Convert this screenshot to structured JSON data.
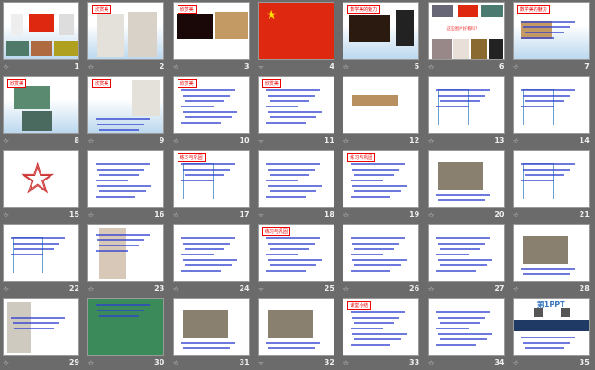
{
  "view": "slide-sorter",
  "colors": {
    "background": "#6b6b6b",
    "title": "#e00000",
    "text": "#3040d0",
    "flag": "#de2910"
  },
  "slides": [
    {
      "n": "1",
      "title": "",
      "kind": "collage"
    },
    {
      "n": "2",
      "title": "欣赏美",
      "kind": "dancers"
    },
    {
      "n": "3",
      "title": "欣赏美",
      "kind": "pyramid"
    },
    {
      "n": "4",
      "title": "",
      "kind": "flag"
    },
    {
      "n": "5",
      "title": "数学美的魅力",
      "kind": "night"
    },
    {
      "n": "6",
      "title": "",
      "caption": "这些图片好看吗？",
      "kind": "gallery"
    },
    {
      "n": "7",
      "title": "数学美的魅力",
      "kind": "pyr2"
    },
    {
      "n": "8",
      "title": "欣赏美",
      "kind": "swan"
    },
    {
      "n": "9",
      "title": "欣赏美",
      "kind": "dancer1"
    },
    {
      "n": "10",
      "title": "欣赏美",
      "kind": "text"
    },
    {
      "n": "11",
      "title": "欣赏美",
      "kind": "text"
    },
    {
      "n": "12",
      "title": "",
      "kind": "scroll"
    },
    {
      "n": "13",
      "title": "",
      "kind": "diagram"
    },
    {
      "n": "14",
      "title": "",
      "kind": "diagram"
    },
    {
      "n": "15",
      "title": "",
      "kind": "star"
    },
    {
      "n": "16",
      "title": "",
      "kind": "text"
    },
    {
      "n": "17",
      "title": "练习与巩固",
      "kind": "diagram"
    },
    {
      "n": "18",
      "title": "",
      "kind": "text"
    },
    {
      "n": "19",
      "title": "练习与巩固",
      "kind": "text"
    },
    {
      "n": "20",
      "title": "",
      "kind": "photo"
    },
    {
      "n": "21",
      "title": "",
      "kind": "diagram"
    },
    {
      "n": "22",
      "title": "",
      "kind": "diagram"
    },
    {
      "n": "23",
      "title": "",
      "kind": "dancer2"
    },
    {
      "n": "24",
      "title": "",
      "kind": "text"
    },
    {
      "n": "25",
      "title": "练习与巩固",
      "kind": "text"
    },
    {
      "n": "26",
      "title": "",
      "kind": "text"
    },
    {
      "n": "27",
      "title": "",
      "kind": "text"
    },
    {
      "n": "28",
      "title": "",
      "kind": "photo"
    },
    {
      "n": "29",
      "title": "",
      "kind": "statue"
    },
    {
      "n": "30",
      "title": "",
      "kind": "green"
    },
    {
      "n": "31",
      "title": "",
      "kind": "photo"
    },
    {
      "n": "32",
      "title": "",
      "kind": "photo"
    },
    {
      "n": "33",
      "title": "课堂小结",
      "kind": "text"
    },
    {
      "n": "34",
      "title": "",
      "kind": "text"
    },
    {
      "n": "35",
      "title": "",
      "logo": "第1PPT",
      "kind": "ppt"
    }
  ]
}
